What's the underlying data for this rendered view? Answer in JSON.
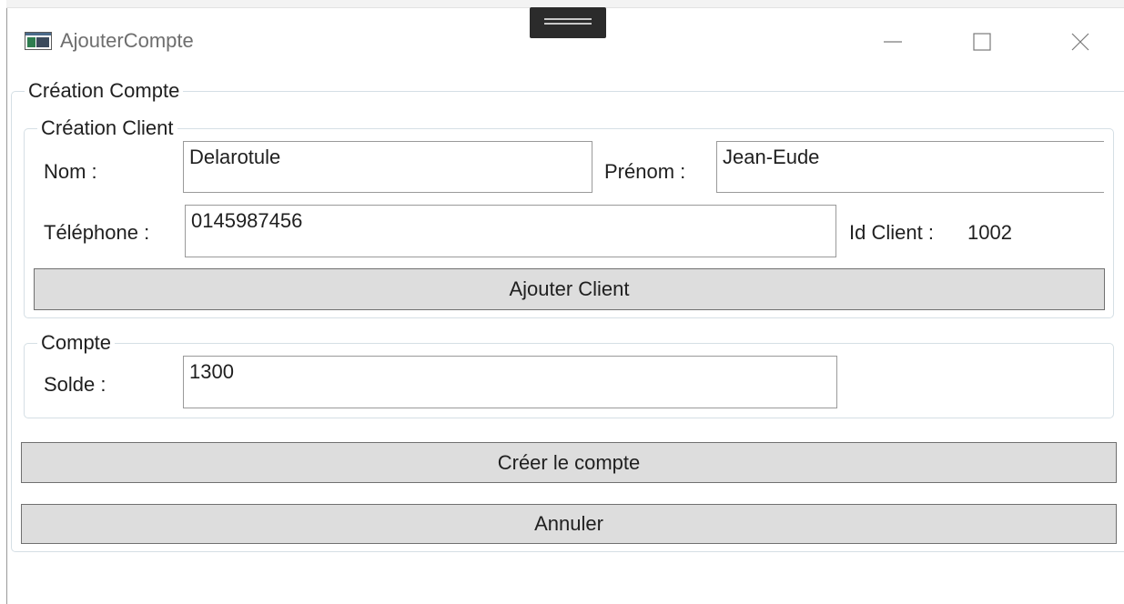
{
  "window": {
    "title": "AjouterCompte"
  },
  "form": {
    "creation_compte_legend": "Création Compte",
    "client": {
      "legend": "Création Client",
      "nom_label": "Nom :",
      "nom_value": "Delarotule",
      "prenom_label": "Prénom :",
      "prenom_value": "Jean-Eude",
      "telephone_label": "Téléphone :",
      "telephone_value": "0145987456",
      "id_client_label": "Id Client :",
      "id_client_value": "1002",
      "ajouter_button": "Ajouter Client"
    },
    "compte": {
      "legend": "Compte",
      "solde_label": "Solde :",
      "solde_value": "1300"
    },
    "creer_button": "Créer le compte",
    "annuler_button": "Annuler"
  },
  "icons": {
    "app": "app-window-icon",
    "minimize": "minimize-icon",
    "maximize": "maximize-icon",
    "close": "close-icon"
  }
}
